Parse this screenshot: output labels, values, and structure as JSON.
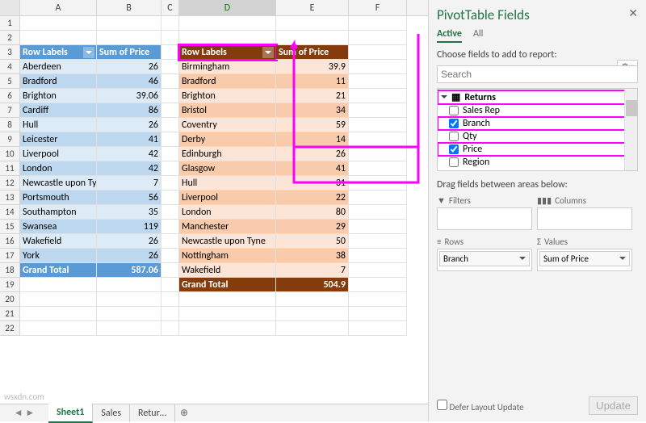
{
  "columns": [
    "A",
    "B",
    "C",
    "D",
    "E",
    "F"
  ],
  "pt1": {
    "row_label_hdr": "Row Labels",
    "value_hdr": "Sum of Price",
    "rows": [
      {
        "label": "Aberdeen",
        "val": "26"
      },
      {
        "label": "Bradford",
        "val": "46"
      },
      {
        "label": "Brighton",
        "val": "39.06"
      },
      {
        "label": "Cardiff",
        "val": "86"
      },
      {
        "label": "Hull",
        "val": "26"
      },
      {
        "label": "Leicester",
        "val": "41"
      },
      {
        "label": "Liverpool",
        "val": "42"
      },
      {
        "label": "London",
        "val": "42"
      },
      {
        "label": "Newcastle upon Tyne",
        "val": "7"
      },
      {
        "label": "Portsmouth",
        "val": "56"
      },
      {
        "label": "Southampton",
        "val": "35"
      },
      {
        "label": "Swansea",
        "val": "119"
      },
      {
        "label": "Wakefield",
        "val": "26"
      },
      {
        "label": "York",
        "val": "26"
      }
    ],
    "total_label": "Grand Total",
    "total_val": "587.06"
  },
  "pt2": {
    "row_label_hdr": "Row Labels",
    "value_hdr": "Sum of Price",
    "rows": [
      {
        "label": "Birmingham",
        "val": "39.9"
      },
      {
        "label": "Bradford",
        "val": "11"
      },
      {
        "label": "Brighton",
        "val": "21"
      },
      {
        "label": "Bristol",
        "val": "34"
      },
      {
        "label": "Coventry",
        "val": "59"
      },
      {
        "label": "Derby",
        "val": "14"
      },
      {
        "label": "Edinburgh",
        "val": "26"
      },
      {
        "label": "Glasgow",
        "val": "41"
      },
      {
        "label": "Hull",
        "val": "31"
      },
      {
        "label": "Liverpool",
        "val": "22"
      },
      {
        "label": "London",
        "val": "80"
      },
      {
        "label": "Manchester",
        "val": "29"
      },
      {
        "label": "Newcastle upon Tyne",
        "val": "50"
      },
      {
        "label": "Nottingham",
        "val": "38"
      },
      {
        "label": "Wakefield",
        "val": "7"
      }
    ],
    "total_label": "Grand Total",
    "total_val": "504.9"
  },
  "tabs": {
    "t1": "Sheet1",
    "t2": "Sales",
    "t3": "Retur…"
  },
  "pane": {
    "title": "PivotTable Fields",
    "tab_active": "Active",
    "tab_all": "All",
    "choose": "Choose fields to add to report:",
    "search_ph": "Search",
    "group": "Returns",
    "f1": "Sales Rep",
    "f2": "Branch",
    "f3": "Qty",
    "f4": "Price",
    "f5": "Region",
    "drag": "Drag fields between areas below:",
    "filters": "Filters",
    "columns": "Columns",
    "rows": "Rows",
    "values": "Values",
    "row_chip": "Branch",
    "val_chip": "Sum of Price",
    "defer": "Defer Layout Update",
    "update": "Update"
  },
  "watermark": "wsxdn.com"
}
